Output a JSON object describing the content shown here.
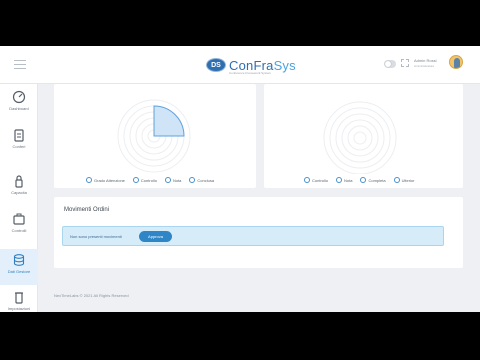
{
  "header": {
    "logo_badge": "DS",
    "logo_part1": "ConFra",
    "logo_part2": "Sys",
    "logo_tagline": "Conference Framework System",
    "user_name": "Admin Rossi",
    "user_role": "Amministratore",
    "icons": [
      "hamburger-icon",
      "dark-mode-toggle",
      "fullscreen-icon",
      "avatar"
    ]
  },
  "sidebar": {
    "items": [
      {
        "label": "Dashboard",
        "icon": "dashboard-icon",
        "active": false
      },
      {
        "label": "Conferi",
        "icon": "clipboard-icon",
        "active": false
      },
      {
        "label": "Capacita",
        "icon": "lock-icon",
        "active": false
      },
      {
        "label": "Controlli",
        "icon": "briefcase-icon",
        "active": false
      },
      {
        "label": "Dati Gestore",
        "icon": "database-icon",
        "active": true
      },
      {
        "label": "Impostazioni",
        "icon": "trash-icon",
        "active": false
      }
    ],
    "active_color": "#2f7fc0"
  },
  "chart_left": {
    "legend": [
      "Grado Attenzione",
      "Controllo",
      "Nota",
      "Conclusa"
    ]
  },
  "chart_right": {
    "legend": [
      "Controllo",
      "Nota",
      "Completa",
      "Ulterior"
    ]
  },
  "movements": {
    "title": "Movimenti Ordini",
    "alert_text": "Non sono presenti movimenti",
    "approve_label": "Approva"
  },
  "footer": {
    "text": "NexTimeLabs © 2021 All Rights Reserved"
  },
  "chart_data": [
    {
      "type": "polar-area",
      "categories": [
        "Grado Attenzione",
        "Controllo",
        "Nota",
        "Conclusa"
      ],
      "values": [
        0,
        1,
        0,
        0
      ]
    },
    {
      "type": "polar-area",
      "categories": [
        "Controllo",
        "Nota",
        "Completa",
        "Ulterior"
      ],
      "values": [
        0,
        0,
        0,
        0
      ]
    }
  ]
}
